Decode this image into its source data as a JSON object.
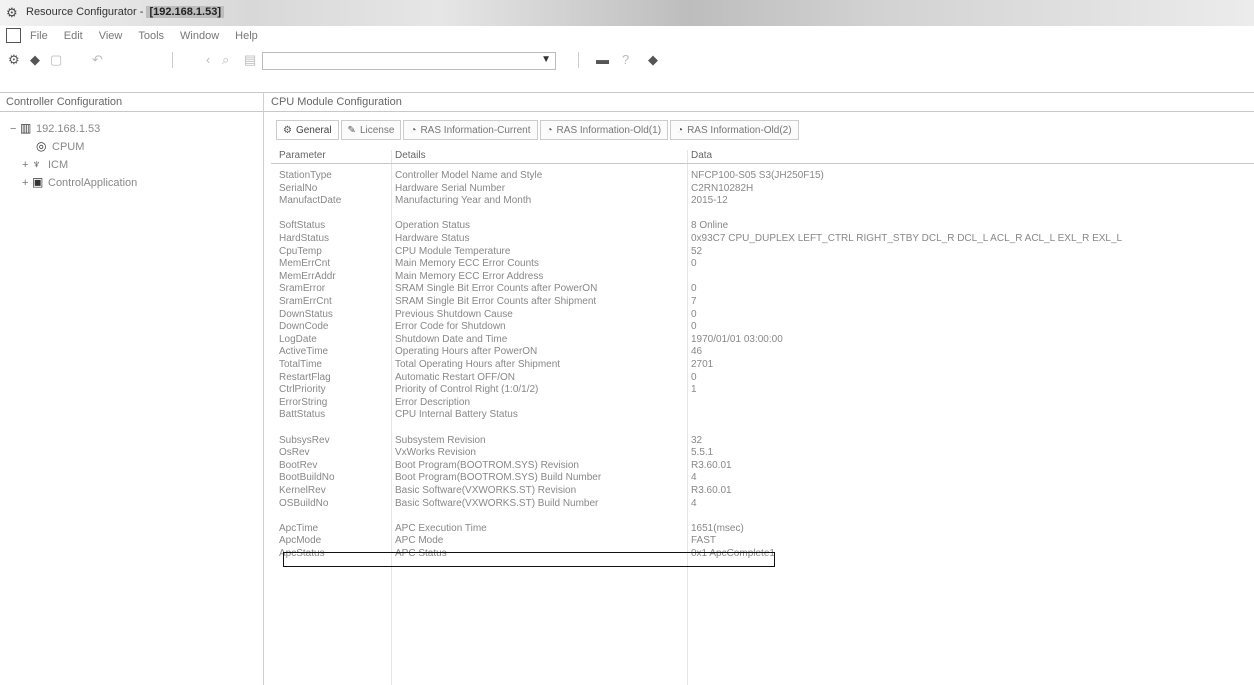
{
  "window": {
    "title_prefix": "Resource Configurator - ",
    "title_ip": "[192.168.1.53]"
  },
  "menu": [
    "File",
    "Edit",
    "View",
    "Tools",
    "Window",
    "Help"
  ],
  "left_panel": {
    "header": "Controller Configuration",
    "tree": [
      {
        "label": "192.168.1.53",
        "icon": "rack-icon",
        "expander": "−"
      },
      {
        "label": "CPUM",
        "icon": "module-icon",
        "expander": ""
      },
      {
        "label": "ICM",
        "icon": "network-icon",
        "expander": "+"
      },
      {
        "label": "ControlApplication",
        "icon": "application-icon",
        "expander": "+"
      }
    ]
  },
  "right_panel": {
    "header": "CPU Module Configuration",
    "tabs": [
      {
        "label": "General",
        "icon": "gear-icon"
      },
      {
        "label": "License",
        "icon": "license-icon"
      },
      {
        "label": "RAS Information-Current",
        "icon": "ras-icon"
      },
      {
        "label": "RAS Information-Old(1)",
        "icon": "ras-icon"
      },
      {
        "label": "RAS Information-Old(2)",
        "icon": "ras-icon"
      }
    ],
    "columns": [
      "Parameter",
      "Details",
      "Data"
    ],
    "rows": [
      {
        "p": "StationType",
        "d": "Controller Model Name and Style",
        "v": "NFCP100-S05 S3(JH250F15)"
      },
      {
        "p": "SerialNo",
        "d": "Hardware Serial Number",
        "v": "C2RN10282H"
      },
      {
        "p": "ManufactDate",
        "d": "Manufacturing Year and Month",
        "v": "2015-12"
      },
      {
        "p": "",
        "d": "",
        "v": ""
      },
      {
        "p": "SoftStatus",
        "d": "Operation Status",
        "v": "8 Online"
      },
      {
        "p": "HardStatus",
        "d": "Hardware Status",
        "v": "0x93C7 CPU_DUPLEX LEFT_CTRL RIGHT_STBY DCL_R DCL_L ACL_R ACL_L EXL_R EXL_L"
      },
      {
        "p": "CpuTemp",
        "d": "CPU Module Temperature",
        "v": "52"
      },
      {
        "p": "MemErrCnt",
        "d": "Main Memory ECC Error Counts",
        "v": "0"
      },
      {
        "p": "MemErrAddr",
        "d": "Main Memory ECC Error Address",
        "v": ""
      },
      {
        "p": "SramError",
        "d": "SRAM Single Bit Error Counts after PowerON",
        "v": "0"
      },
      {
        "p": "SramErrCnt",
        "d": "SRAM Single Bit Error Counts after Shipment",
        "v": "7"
      },
      {
        "p": "DownStatus",
        "d": "Previous Shutdown Cause",
        "v": "0"
      },
      {
        "p": "DownCode",
        "d": "Error Code for Shutdown",
        "v": "0"
      },
      {
        "p": "LogDate",
        "d": "Shutdown Date and Time",
        "v": "1970/01/01 03:00:00"
      },
      {
        "p": "ActiveTime",
        "d": "Operating Hours after PowerON",
        "v": "46"
      },
      {
        "p": "TotalTime",
        "d": "Total Operating Hours after Shipment",
        "v": "2701"
      },
      {
        "p": "RestartFlag",
        "d": "Automatic Restart OFF/ON",
        "v": "0"
      },
      {
        "p": "CtrlPriority",
        "d": "Priority of Control Right (1:0/1/2)",
        "v": "1"
      },
      {
        "p": "ErrorString",
        "d": "Error Description",
        "v": ""
      },
      {
        "p": "BattStatus",
        "d": "CPU Internal Battery Status",
        "v": ""
      },
      {
        "p": "",
        "d": "",
        "v": ""
      },
      {
        "p": "SubsysRev",
        "d": "Subsystem Revision",
        "v": "32"
      },
      {
        "p": "OsRev",
        "d": "VxWorks Revision",
        "v": "5.5.1"
      },
      {
        "p": "BootRev",
        "d": "Boot Program(BOOTROM.SYS) Revision",
        "v": "R3.60.01"
      },
      {
        "p": "BootBuildNo",
        "d": "Boot Program(BOOTROM.SYS) Build Number",
        "v": "4"
      },
      {
        "p": "KernelRev",
        "d": "Basic Software(VXWORKS.ST) Revision",
        "v": "R3.60.01"
      },
      {
        "p": "OSBuildNo",
        "d": "Basic Software(VXWORKS.ST) Build Number",
        "v": "4"
      },
      {
        "p": "",
        "d": "",
        "v": ""
      },
      {
        "p": "ApcTime",
        "d": "APC Execution Time",
        "v": "1651(msec)"
      },
      {
        "p": "ApcMode",
        "d": "APC Mode",
        "v": "FAST"
      },
      {
        "p": "ApcStatus",
        "d": "APC Status",
        "v": "0x1 ApcComplete1"
      }
    ]
  }
}
